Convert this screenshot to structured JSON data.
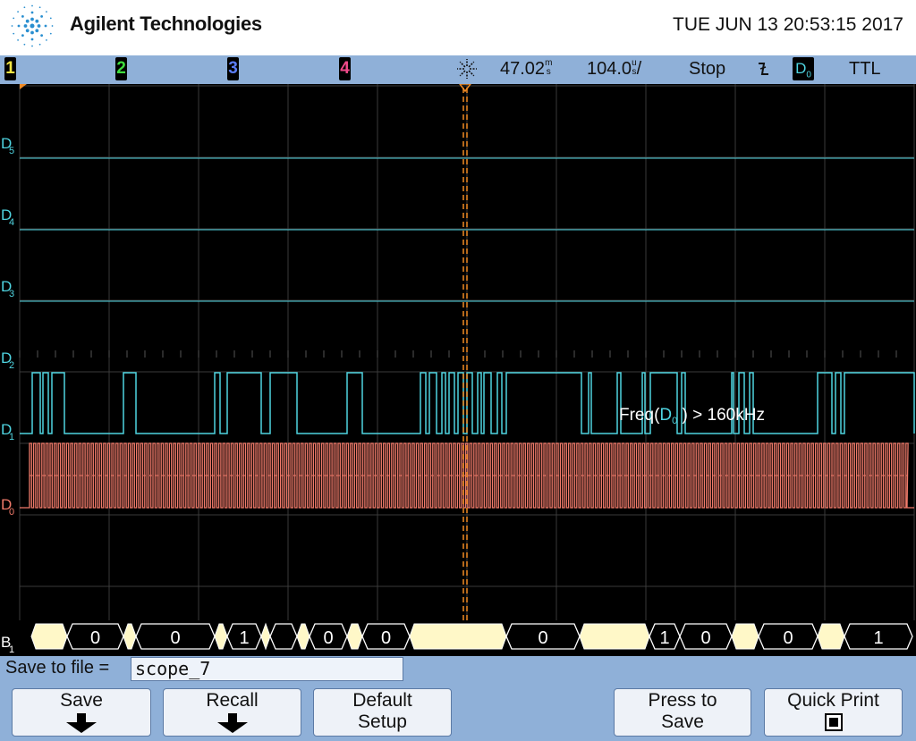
{
  "header": {
    "brand": "Agilent Technologies",
    "datetime": "TUE JUN 13 20:53:15 2017",
    "logo_icon": "agilent-spark-logo"
  },
  "status_bar": {
    "channels": [
      {
        "label": "1",
        "color": "#f4e542"
      },
      {
        "label": "2",
        "color": "#3fdc3f"
      },
      {
        "label": "3",
        "color": "#5b7df5"
      },
      {
        "label": "4",
        "color": "#f04a8a"
      }
    ],
    "trigger_icon": "acquisition-spark-icon",
    "delay_value": "47.02",
    "delay_unit": "m",
    "delay_unit2": "s",
    "timebase_value": "104.0",
    "timebase_unit": "u",
    "timebase_unit2": "s",
    "timebase_suffix": "/",
    "run_state": "Stop",
    "edge_icon": "falling-edge-icon",
    "trigger_source": "D",
    "trigger_source_sub": "0",
    "threshold": "TTL"
  },
  "channels": {
    "d5": {
      "letter": "D",
      "sub": "5"
    },
    "d4": {
      "letter": "D",
      "sub": "4"
    },
    "d3": {
      "letter": "D",
      "sub": "3"
    },
    "d2": {
      "letter": "D",
      "sub": "2"
    },
    "d1": {
      "letter": "D",
      "sub": "1"
    },
    "d0": {
      "letter": "D",
      "sub": "0"
    },
    "bus": {
      "letter": "B",
      "sub": "1"
    }
  },
  "measurement": {
    "prefix": "Freq(",
    "source": "D",
    "source_sub": "0",
    "suffix": ") > 160kHz"
  },
  "bus_values": [
    "0",
    "0",
    "1",
    "0",
    "0",
    "0",
    "1",
    "0",
    "0",
    "1"
  ],
  "colors": {
    "digital": "#4fd4e0",
    "d0": "#f07a6a",
    "grid": "#3a3a3a",
    "bus_fill": "#fff8c8",
    "cursor": "#f08a24",
    "panel": "#8fb0d8"
  },
  "save": {
    "label": "Save to file =",
    "filename": "scope_7"
  },
  "softkeys": {
    "save": "Save",
    "recall": "Recall",
    "default_l1": "Default",
    "default_l2": "Setup",
    "press_l1": "Press to",
    "press_l2": "Save",
    "quick_print": "Quick Print"
  }
}
